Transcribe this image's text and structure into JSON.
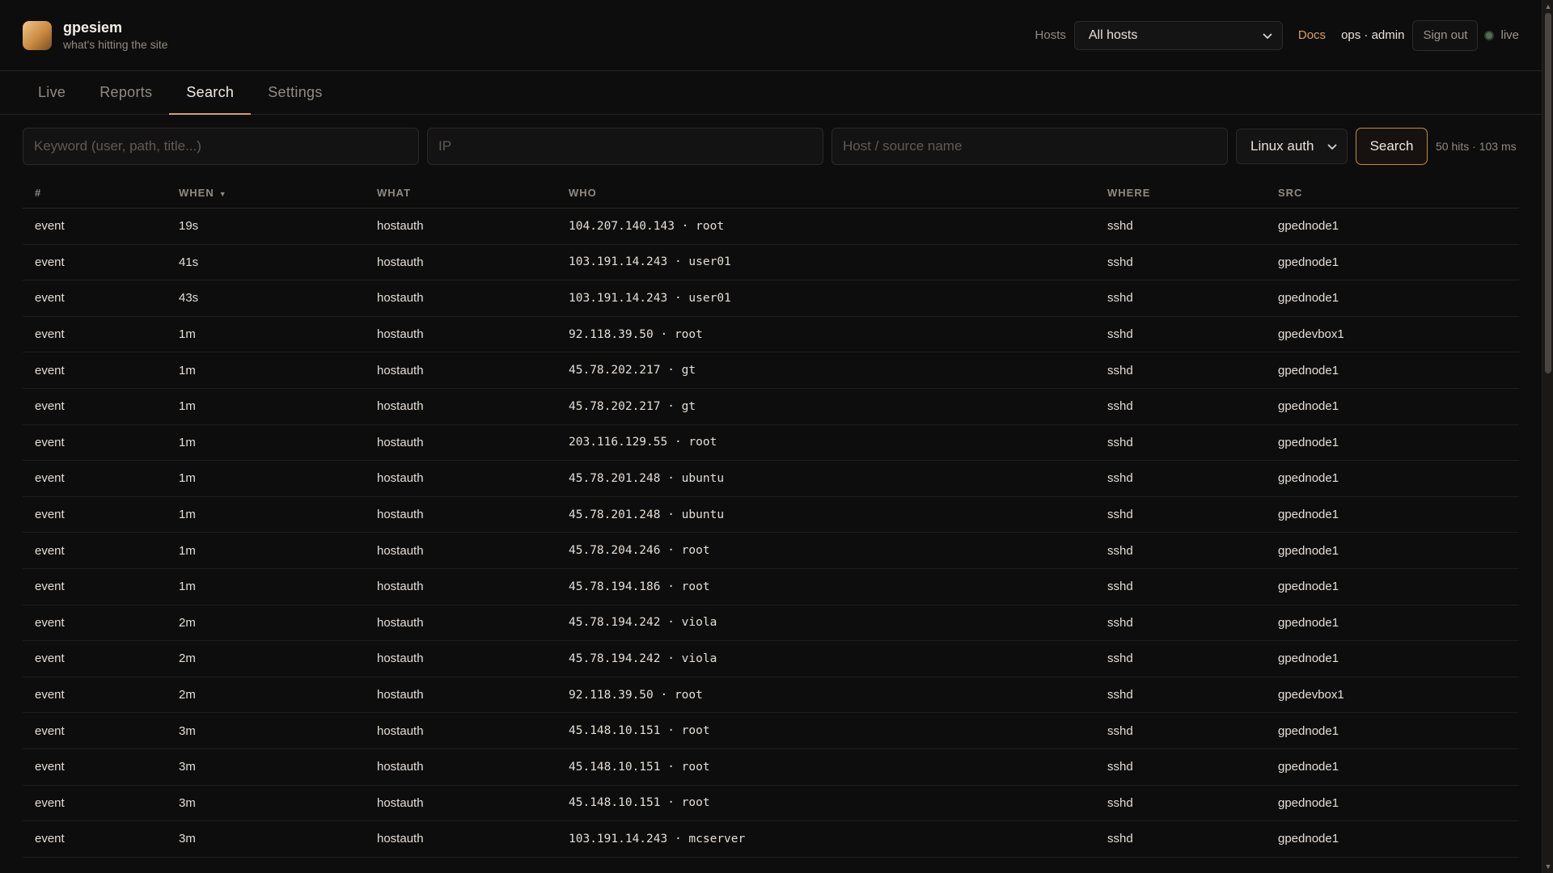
{
  "app": {
    "name": "gpesiem",
    "tagline": "what's hitting the site"
  },
  "header": {
    "hosts_label": "Hosts",
    "hosts_selected": "All hosts",
    "docs_label": "Docs",
    "user_label": "ops · admin",
    "signout_label": "Sign out",
    "live_label": "live"
  },
  "tabs": [
    {
      "label": "Live",
      "active": false
    },
    {
      "label": "Reports",
      "active": false
    },
    {
      "label": "Search",
      "active": true
    },
    {
      "label": "Settings",
      "active": false
    }
  ],
  "search": {
    "keyword_placeholder": "Keyword (user, path, title...)",
    "ip_placeholder": "IP",
    "host_placeholder": "Host / source name",
    "type_selected": "Linux auth",
    "button_label": "Search",
    "stats": "50 hits · 103 ms"
  },
  "table": {
    "columns": [
      "#",
      "WHEN",
      "WHAT",
      "WHO",
      "WHERE",
      "SRC"
    ],
    "sort_indicator": "▼",
    "rows": [
      {
        "num": "event",
        "when": "19s",
        "what": "hostauth",
        "who": "104.207.140.143 · root",
        "where": "sshd",
        "src": "gpednode1"
      },
      {
        "num": "event",
        "when": "41s",
        "what": "hostauth",
        "who": "103.191.14.243 · user01",
        "where": "sshd",
        "src": "gpednode1"
      },
      {
        "num": "event",
        "when": "43s",
        "what": "hostauth",
        "who": "103.191.14.243 · user01",
        "where": "sshd",
        "src": "gpednode1"
      },
      {
        "num": "event",
        "when": "1m",
        "what": "hostauth",
        "who": "92.118.39.50 · root",
        "where": "sshd",
        "src": "gpedevbox1"
      },
      {
        "num": "event",
        "when": "1m",
        "what": "hostauth",
        "who": "45.78.202.217 · gt",
        "where": "sshd",
        "src": "gpednode1"
      },
      {
        "num": "event",
        "when": "1m",
        "what": "hostauth",
        "who": "45.78.202.217 · gt",
        "where": "sshd",
        "src": "gpednode1"
      },
      {
        "num": "event",
        "when": "1m",
        "what": "hostauth",
        "who": "203.116.129.55 · root",
        "where": "sshd",
        "src": "gpednode1"
      },
      {
        "num": "event",
        "when": "1m",
        "what": "hostauth",
        "who": "45.78.201.248 · ubuntu",
        "where": "sshd",
        "src": "gpednode1"
      },
      {
        "num": "event",
        "when": "1m",
        "what": "hostauth",
        "who": "45.78.201.248 · ubuntu",
        "where": "sshd",
        "src": "gpednode1"
      },
      {
        "num": "event",
        "when": "1m",
        "what": "hostauth",
        "who": "45.78.204.246 · root",
        "where": "sshd",
        "src": "gpednode1"
      },
      {
        "num": "event",
        "when": "1m",
        "what": "hostauth",
        "who": "45.78.194.186 · root",
        "where": "sshd",
        "src": "gpednode1"
      },
      {
        "num": "event",
        "when": "2m",
        "what": "hostauth",
        "who": "45.78.194.242 · viola",
        "where": "sshd",
        "src": "gpednode1"
      },
      {
        "num": "event",
        "when": "2m",
        "what": "hostauth",
        "who": "45.78.194.242 · viola",
        "where": "sshd",
        "src": "gpednode1"
      },
      {
        "num": "event",
        "when": "2m",
        "what": "hostauth",
        "who": "92.118.39.50 · root",
        "where": "sshd",
        "src": "gpedevbox1"
      },
      {
        "num": "event",
        "when": "3m",
        "what": "hostauth",
        "who": "45.148.10.151 · root",
        "where": "sshd",
        "src": "gpednode1"
      },
      {
        "num": "event",
        "when": "3m",
        "what": "hostauth",
        "who": "45.148.10.151 · root",
        "where": "sshd",
        "src": "gpednode1"
      },
      {
        "num": "event",
        "when": "3m",
        "what": "hostauth",
        "who": "45.148.10.151 · root",
        "where": "sshd",
        "src": "gpednode1"
      },
      {
        "num": "event",
        "when": "3m",
        "what": "hostauth",
        "who": "103.191.14.243 · mcserver",
        "where": "sshd",
        "src": "gpednode1"
      }
    ]
  },
  "colors": {
    "accent": "#d7a15a",
    "background": "#0e0d0d",
    "live_dot": "#4f6e5a"
  },
  "icons": {
    "logo": "app-logo-icon",
    "caret": "chevron-down-icon",
    "live": "status-dot-icon"
  }
}
